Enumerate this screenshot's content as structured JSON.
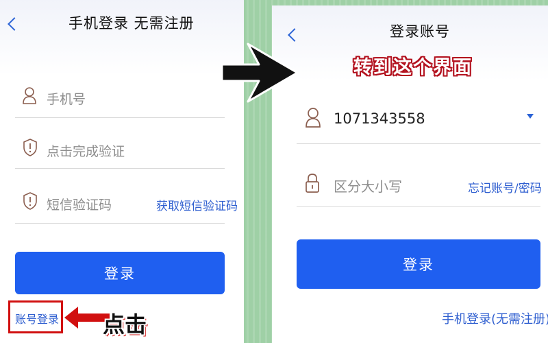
{
  "left": {
    "title": "手机登录 无需注册",
    "phone_placeholder": "手机号",
    "verify_placeholder": "点击完成验证",
    "sms_placeholder": "短信验证码",
    "get_sms_link": "获取短信验证码",
    "login_button": "登录",
    "account_login_link": "账号登录"
  },
  "right": {
    "title": "登录账号",
    "account_value": "1071343558",
    "password_placeholder": "区分大小写",
    "forgot_link": "忘记账号/密码",
    "login_button": "登录",
    "phone_login_link": "手机登录(无需注册)"
  },
  "annotations": {
    "click_label": "点击",
    "goto_label": "转到这个界面",
    "highlight_color": "#d11010",
    "arrow_color": "#111111"
  },
  "colors": {
    "primary_button": "#1f5ff0",
    "link": "#2f5fd0",
    "background_stripe": "#9fd0a6"
  },
  "icons": {
    "back": "chevron-left-icon",
    "user": "user-icon",
    "shield": "shield-icon",
    "lock": "lock-icon",
    "dropdown": "caret-down-icon"
  }
}
